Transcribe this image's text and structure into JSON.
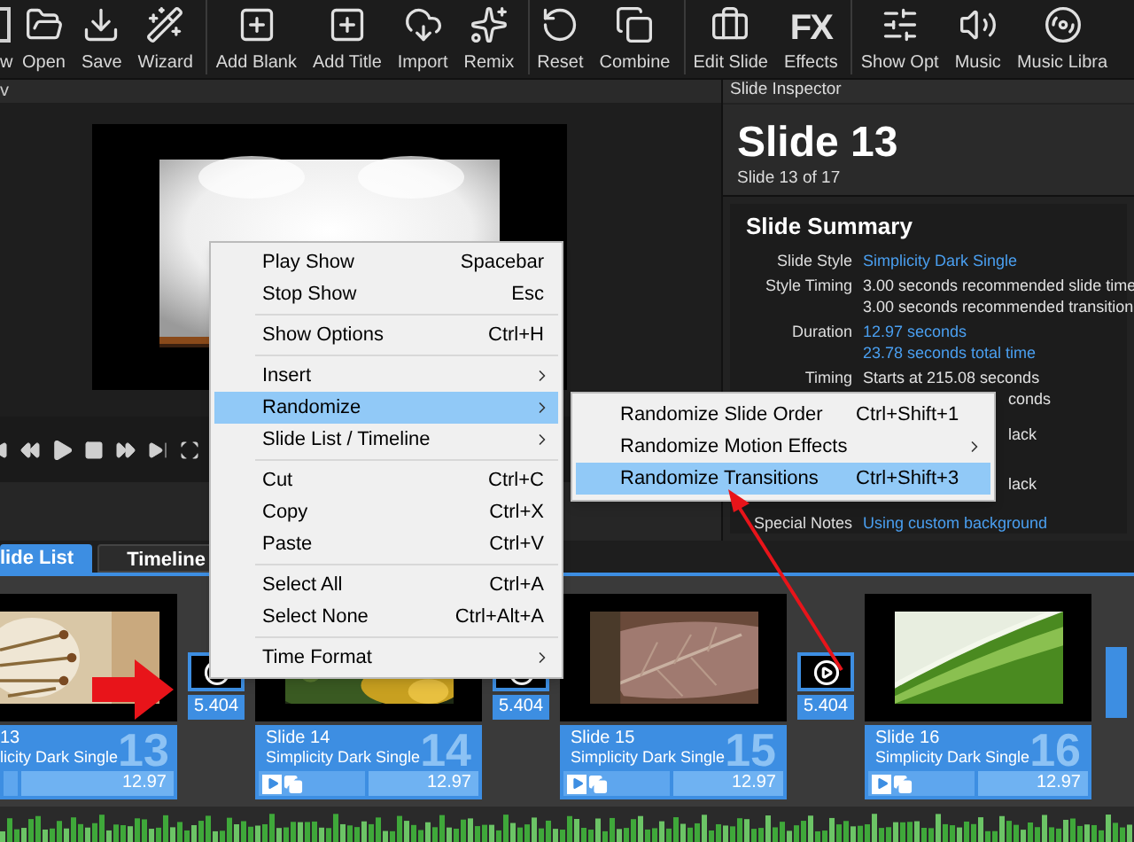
{
  "toolbar": {
    "items": [
      {
        "label": "w",
        "separator_before": false
      },
      {
        "label": "Open",
        "separator_before": false
      },
      {
        "label": "Save",
        "separator_before": false
      },
      {
        "label": "Wizard",
        "separator_before": false
      },
      {
        "label": "Add Blank",
        "separator_before": true
      },
      {
        "label": "Add Title",
        "separator_before": false
      },
      {
        "label": "Import",
        "separator_before": false
      },
      {
        "label": "Remix",
        "separator_before": false
      },
      {
        "label": "Reset",
        "separator_before": true
      },
      {
        "label": "Combine",
        "separator_before": false
      },
      {
        "label": "Edit Slide",
        "separator_before": true
      },
      {
        "label": "Effects",
        "icon_text": "FX",
        "separator_before": false
      },
      {
        "label": "Show Opt",
        "separator_before": true
      },
      {
        "label": "Music",
        "separator_before": false
      },
      {
        "label": "Music Libra",
        "separator_before": false
      }
    ]
  },
  "preview": {
    "title": "v"
  },
  "inspector": {
    "title": "Slide Inspector",
    "slide_title": "Slide 13",
    "slide_subtitle": "Slide 13 of 17",
    "summary": {
      "heading": "Slide Summary",
      "rows": [
        {
          "label": "Slide Style",
          "lines": [
            {
              "text": "Simplicity Dark Single",
              "link": true,
              "cut": false
            }
          ]
        },
        {
          "label": "Style Timing",
          "lines": [
            {
              "text": "3.00 seconds recommended slide time",
              "link": false,
              "cut": false
            },
            {
              "text": "3.00 seconds recommended transition",
              "link": false,
              "cut": false
            }
          ]
        },
        {
          "label": "Duration",
          "lines": [
            {
              "text": "12.97 seconds",
              "link": true,
              "cut": false
            },
            {
              "text": "23.78 seconds total time",
              "link": true,
              "cut": false
            }
          ]
        },
        {
          "label": "Timing",
          "lines": [
            {
              "text": "Starts at 215.08 seconds",
              "link": false,
              "cut": false
            },
            {
              "text": "conds",
              "link": false,
              "cut": true
            }
          ]
        },
        {
          "lines": [
            {
              "text": "lack",
              "link": false,
              "cut": true
            }
          ]
        },
        {
          "lines": [
            {
              "text": "lack",
              "link": false,
              "cut": true
            }
          ]
        },
        {
          "label": "Special Notes",
          "lines": [
            {
              "text": "Using custom background",
              "link": true,
              "cut": false
            }
          ]
        }
      ]
    }
  },
  "tabs": [
    {
      "label": "lide List",
      "selected": true
    },
    {
      "label": "Timeline",
      "selected": false
    }
  ],
  "slides": [
    {
      "kind": "cut",
      "title": "13",
      "style": "licity Dark Single",
      "number": "13",
      "duration": "12.97",
      "transition": "5.404"
    },
    {
      "kind": "full",
      "title": "Slide 14",
      "style": "Simplicity Dark Single",
      "number": "14",
      "duration": "12.97",
      "transition": "5.404"
    },
    {
      "kind": "full",
      "title": "Slide 15",
      "style": "Simplicity Dark Single",
      "number": "15",
      "duration": "12.97",
      "transition": "5.404"
    },
    {
      "kind": "full",
      "title": "Slide 16",
      "style": "Simplicity Dark Single",
      "number": "16",
      "duration": "12.97"
    }
  ],
  "context_menu": {
    "groups": [
      [
        {
          "label": "Play Show",
          "shortcut": "Spacebar",
          "submenu": false,
          "selected": false
        },
        {
          "label": "Stop Show",
          "shortcut": "Esc",
          "submenu": false,
          "selected": false
        }
      ],
      [
        {
          "label": "Show Options",
          "shortcut": "Ctrl+H",
          "submenu": false,
          "selected": false
        }
      ],
      [
        {
          "label": "Insert",
          "submenu": true,
          "selected": false
        },
        {
          "label": "Randomize",
          "submenu": true,
          "selected": true
        },
        {
          "label": "Slide List / Timeline",
          "submenu": true,
          "selected": false
        }
      ],
      [
        {
          "label": "Cut",
          "shortcut": "Ctrl+C",
          "submenu": false,
          "selected": false
        },
        {
          "label": "Copy",
          "shortcut": "Ctrl+X",
          "submenu": false,
          "selected": false
        },
        {
          "label": "Paste",
          "shortcut": "Ctrl+V",
          "submenu": false,
          "selected": false
        }
      ],
      [
        {
          "label": "Select All",
          "shortcut": "Ctrl+A",
          "submenu": false,
          "selected": false
        },
        {
          "label": "Select None",
          "shortcut": "Ctrl+Alt+A",
          "submenu": false,
          "selected": false
        }
      ],
      [
        {
          "label": "Time Format",
          "submenu": true,
          "selected": false
        }
      ]
    ]
  },
  "submenu": {
    "items": [
      {
        "label": "Randomize Slide Order",
        "shortcut": "Ctrl+Shift+1",
        "submenu": false,
        "selected": false
      },
      {
        "label": "Randomize Motion Effects",
        "submenu": true,
        "selected": false
      },
      {
        "label": "Randomize Transitions",
        "shortcut": "Ctrl+Shift+3",
        "submenu": false,
        "selected": true
      }
    ]
  }
}
